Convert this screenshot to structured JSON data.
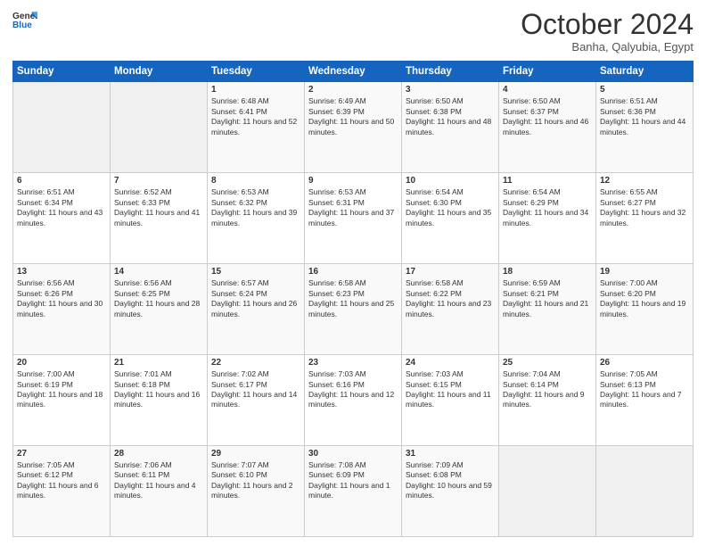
{
  "logo": {
    "line1": "General",
    "line2": "Blue"
  },
  "header": {
    "month": "October 2024",
    "location": "Banha, Qalyubia, Egypt"
  },
  "days_of_week": [
    "Sunday",
    "Monday",
    "Tuesday",
    "Wednesday",
    "Thursday",
    "Friday",
    "Saturday"
  ],
  "weeks": [
    [
      {
        "day": "",
        "sunrise": "",
        "sunset": "",
        "daylight": ""
      },
      {
        "day": "",
        "sunrise": "",
        "sunset": "",
        "daylight": ""
      },
      {
        "day": "1",
        "sunrise": "Sunrise: 6:48 AM",
        "sunset": "Sunset: 6:41 PM",
        "daylight": "Daylight: 11 hours and 52 minutes."
      },
      {
        "day": "2",
        "sunrise": "Sunrise: 6:49 AM",
        "sunset": "Sunset: 6:39 PM",
        "daylight": "Daylight: 11 hours and 50 minutes."
      },
      {
        "day": "3",
        "sunrise": "Sunrise: 6:50 AM",
        "sunset": "Sunset: 6:38 PM",
        "daylight": "Daylight: 11 hours and 48 minutes."
      },
      {
        "day": "4",
        "sunrise": "Sunrise: 6:50 AM",
        "sunset": "Sunset: 6:37 PM",
        "daylight": "Daylight: 11 hours and 46 minutes."
      },
      {
        "day": "5",
        "sunrise": "Sunrise: 6:51 AM",
        "sunset": "Sunset: 6:36 PM",
        "daylight": "Daylight: 11 hours and 44 minutes."
      }
    ],
    [
      {
        "day": "6",
        "sunrise": "Sunrise: 6:51 AM",
        "sunset": "Sunset: 6:34 PM",
        "daylight": "Daylight: 11 hours and 43 minutes."
      },
      {
        "day": "7",
        "sunrise": "Sunrise: 6:52 AM",
        "sunset": "Sunset: 6:33 PM",
        "daylight": "Daylight: 11 hours and 41 minutes."
      },
      {
        "day": "8",
        "sunrise": "Sunrise: 6:53 AM",
        "sunset": "Sunset: 6:32 PM",
        "daylight": "Daylight: 11 hours and 39 minutes."
      },
      {
        "day": "9",
        "sunrise": "Sunrise: 6:53 AM",
        "sunset": "Sunset: 6:31 PM",
        "daylight": "Daylight: 11 hours and 37 minutes."
      },
      {
        "day": "10",
        "sunrise": "Sunrise: 6:54 AM",
        "sunset": "Sunset: 6:30 PM",
        "daylight": "Daylight: 11 hours and 35 minutes."
      },
      {
        "day": "11",
        "sunrise": "Sunrise: 6:54 AM",
        "sunset": "Sunset: 6:29 PM",
        "daylight": "Daylight: 11 hours and 34 minutes."
      },
      {
        "day": "12",
        "sunrise": "Sunrise: 6:55 AM",
        "sunset": "Sunset: 6:27 PM",
        "daylight": "Daylight: 11 hours and 32 minutes."
      }
    ],
    [
      {
        "day": "13",
        "sunrise": "Sunrise: 6:56 AM",
        "sunset": "Sunset: 6:26 PM",
        "daylight": "Daylight: 11 hours and 30 minutes."
      },
      {
        "day": "14",
        "sunrise": "Sunrise: 6:56 AM",
        "sunset": "Sunset: 6:25 PM",
        "daylight": "Daylight: 11 hours and 28 minutes."
      },
      {
        "day": "15",
        "sunrise": "Sunrise: 6:57 AM",
        "sunset": "Sunset: 6:24 PM",
        "daylight": "Daylight: 11 hours and 26 minutes."
      },
      {
        "day": "16",
        "sunrise": "Sunrise: 6:58 AM",
        "sunset": "Sunset: 6:23 PM",
        "daylight": "Daylight: 11 hours and 25 minutes."
      },
      {
        "day": "17",
        "sunrise": "Sunrise: 6:58 AM",
        "sunset": "Sunset: 6:22 PM",
        "daylight": "Daylight: 11 hours and 23 minutes."
      },
      {
        "day": "18",
        "sunrise": "Sunrise: 6:59 AM",
        "sunset": "Sunset: 6:21 PM",
        "daylight": "Daylight: 11 hours and 21 minutes."
      },
      {
        "day": "19",
        "sunrise": "Sunrise: 7:00 AM",
        "sunset": "Sunset: 6:20 PM",
        "daylight": "Daylight: 11 hours and 19 minutes."
      }
    ],
    [
      {
        "day": "20",
        "sunrise": "Sunrise: 7:00 AM",
        "sunset": "Sunset: 6:19 PM",
        "daylight": "Daylight: 11 hours and 18 minutes."
      },
      {
        "day": "21",
        "sunrise": "Sunrise: 7:01 AM",
        "sunset": "Sunset: 6:18 PM",
        "daylight": "Daylight: 11 hours and 16 minutes."
      },
      {
        "day": "22",
        "sunrise": "Sunrise: 7:02 AM",
        "sunset": "Sunset: 6:17 PM",
        "daylight": "Daylight: 11 hours and 14 minutes."
      },
      {
        "day": "23",
        "sunrise": "Sunrise: 7:03 AM",
        "sunset": "Sunset: 6:16 PM",
        "daylight": "Daylight: 11 hours and 12 minutes."
      },
      {
        "day": "24",
        "sunrise": "Sunrise: 7:03 AM",
        "sunset": "Sunset: 6:15 PM",
        "daylight": "Daylight: 11 hours and 11 minutes."
      },
      {
        "day": "25",
        "sunrise": "Sunrise: 7:04 AM",
        "sunset": "Sunset: 6:14 PM",
        "daylight": "Daylight: 11 hours and 9 minutes."
      },
      {
        "day": "26",
        "sunrise": "Sunrise: 7:05 AM",
        "sunset": "Sunset: 6:13 PM",
        "daylight": "Daylight: 11 hours and 7 minutes."
      }
    ],
    [
      {
        "day": "27",
        "sunrise": "Sunrise: 7:05 AM",
        "sunset": "Sunset: 6:12 PM",
        "daylight": "Daylight: 11 hours and 6 minutes."
      },
      {
        "day": "28",
        "sunrise": "Sunrise: 7:06 AM",
        "sunset": "Sunset: 6:11 PM",
        "daylight": "Daylight: 11 hours and 4 minutes."
      },
      {
        "day": "29",
        "sunrise": "Sunrise: 7:07 AM",
        "sunset": "Sunset: 6:10 PM",
        "daylight": "Daylight: 11 hours and 2 minutes."
      },
      {
        "day": "30",
        "sunrise": "Sunrise: 7:08 AM",
        "sunset": "Sunset: 6:09 PM",
        "daylight": "Daylight: 11 hours and 1 minute."
      },
      {
        "day": "31",
        "sunrise": "Sunrise: 7:09 AM",
        "sunset": "Sunset: 6:08 PM",
        "daylight": "Daylight: 10 hours and 59 minutes."
      },
      {
        "day": "",
        "sunrise": "",
        "sunset": "",
        "daylight": ""
      },
      {
        "day": "",
        "sunrise": "",
        "sunset": "",
        "daylight": ""
      }
    ]
  ]
}
